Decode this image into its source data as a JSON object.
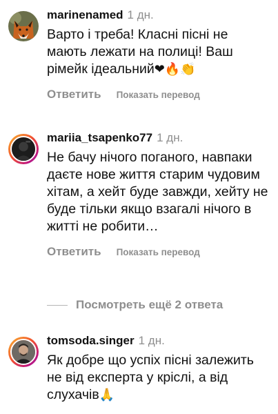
{
  "comments": [
    {
      "username": "marinenamed",
      "time": "1 дн.",
      "text": "Варто і треба! Класні пісні не мають лежати на полиці! Ваш рімейк ідеальний",
      "emoji": "❤🔥👏",
      "reply_label": "Ответить",
      "translate_label": "Показать перевод"
    },
    {
      "username": "mariia_tsapenko77",
      "time": "1 дн.",
      "text": "Не бачу нічого поганого, навпаки даєте нове життя старим чудовим хітам, а хейт буде завжди, хейту не буде тільки якщо взагалі нічого в житті не робити…",
      "reply_label": "Ответить",
      "translate_label": "Показать перевод"
    },
    {
      "username": "tomsoda.singer",
      "time": "1 дн.",
      "text": "Як добре що успіх пісні залежить не від експерта у кріслі, а від слухачів",
      "emoji": "🙏"
    }
  ],
  "view_more_label": "Посмотреть ещё 2 ответа",
  "icons": {
    "avatar_1": "fox-avatar",
    "avatar_2": "dark-profile-avatar",
    "avatar_3": "man-profile-avatar"
  },
  "colors": {
    "text": "#111111",
    "secondary": "#8e8e8e",
    "story_ring_start": "#f7b733",
    "story_ring_end": "#833ab4"
  }
}
